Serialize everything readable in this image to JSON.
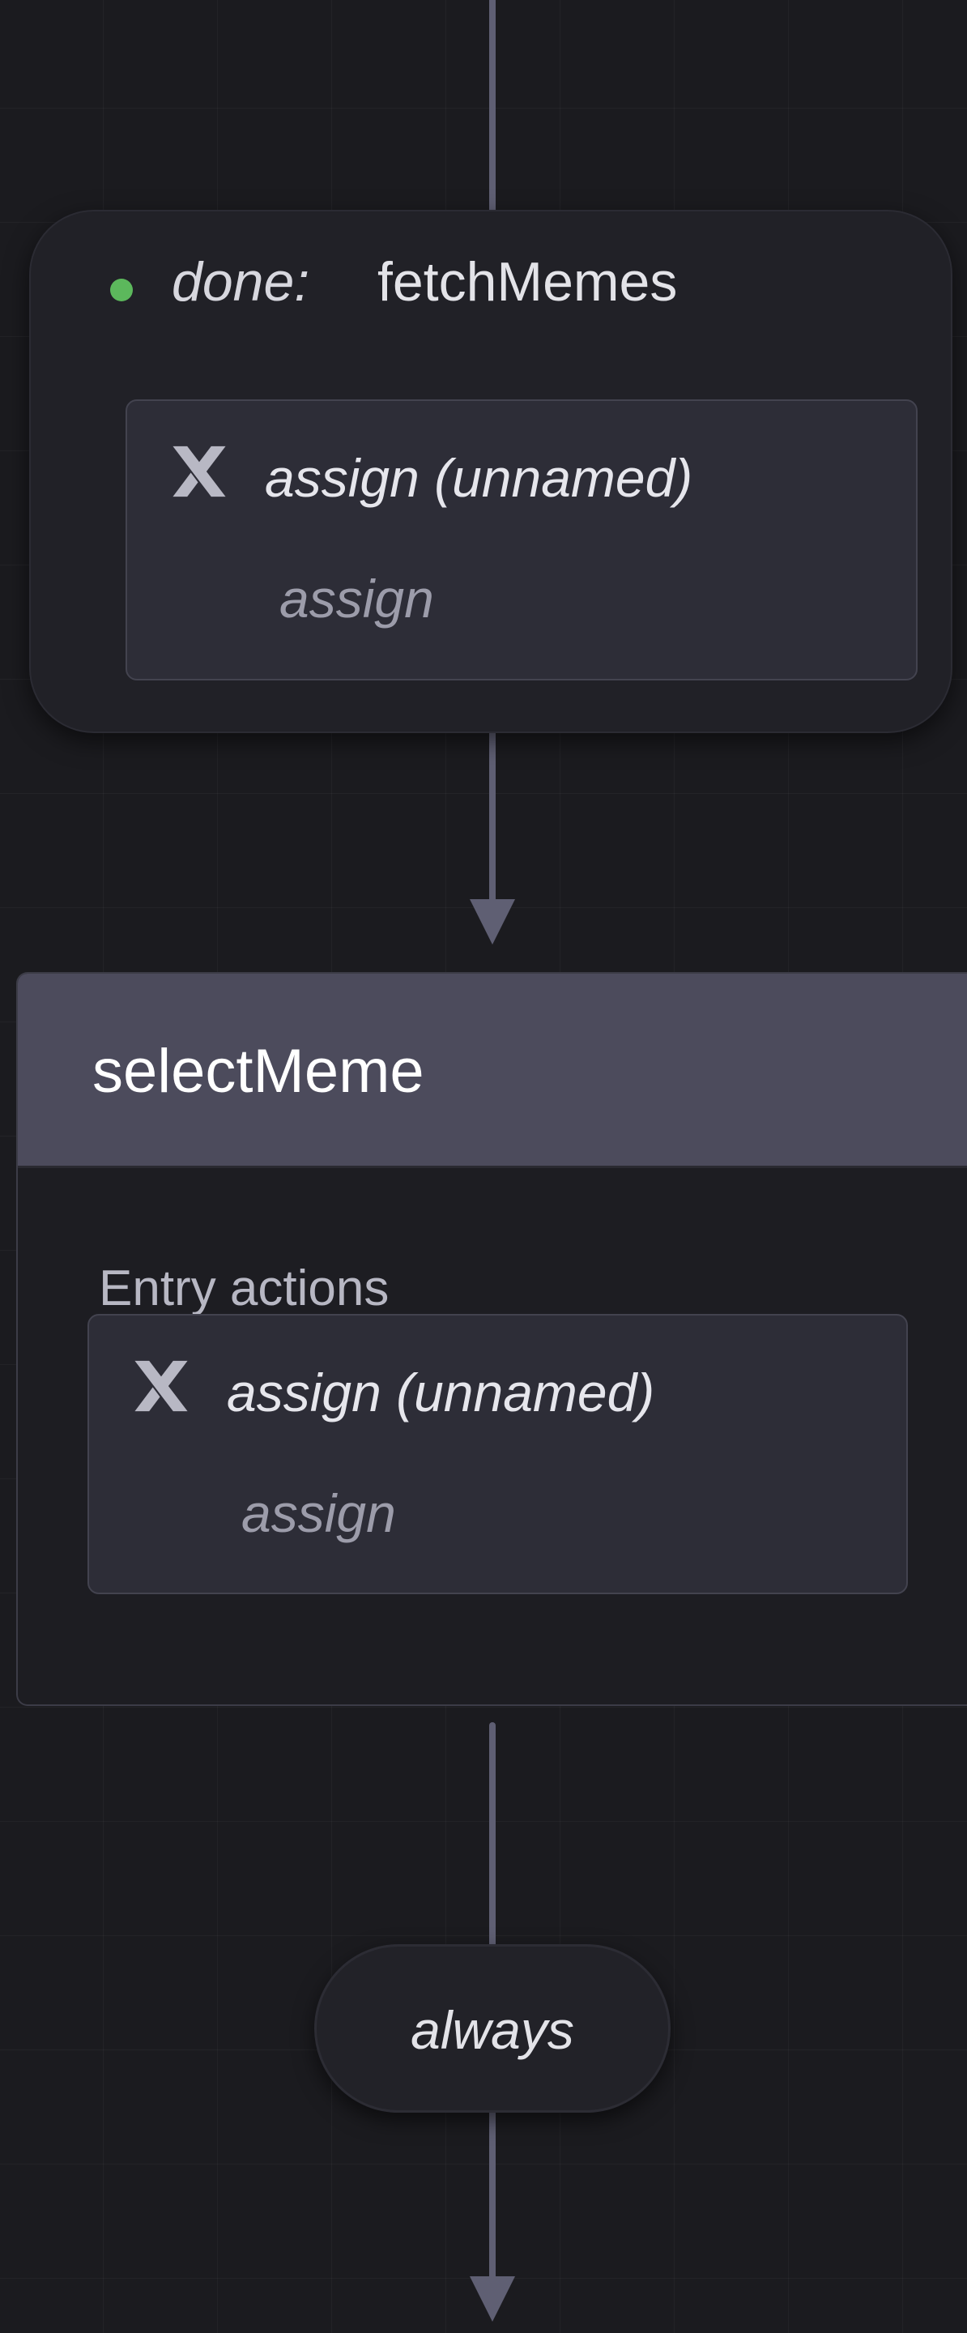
{
  "transition_event": {
    "kind": "done:",
    "name": "fetchMemes",
    "status_color": "#5cb85c",
    "action": {
      "icon": "xstate-x-icon",
      "title": "assign (unnamed)",
      "type": "assign"
    }
  },
  "state": {
    "name": "selectMeme",
    "entry_label": "Entry actions",
    "entry_action": {
      "icon": "xstate-x-icon",
      "title": "assign (unnamed)",
      "type": "assign"
    }
  },
  "eventless_transition": {
    "label": "always"
  },
  "colors": {
    "background": "#1b1b1f",
    "edge": "#5f5f73",
    "state_header": "#4c4b5c",
    "action_card": "#2d2d37"
  }
}
